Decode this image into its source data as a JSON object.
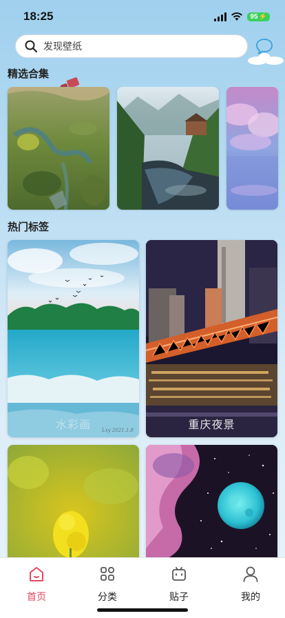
{
  "status_bar": {
    "time": "18:25",
    "battery": "95",
    "battery_color": "#39d15c"
  },
  "search": {
    "placeholder": "发现壁纸",
    "icon": "search-icon"
  },
  "header": {
    "chat_icon": "chat-bubble-icon"
  },
  "sections": {
    "featured_title": "精选合集",
    "tags_title": "热门标签"
  },
  "featured": [
    {
      "name": "aerial-valley"
    },
    {
      "name": "mountain-river-village"
    },
    {
      "name": "pink-clouds-sea"
    }
  ],
  "tags": [
    {
      "label": "水彩画",
      "signature": "Lxy 2021.1.8"
    },
    {
      "label": "重庆夜景"
    },
    {
      "label": ""
    },
    {
      "label": ""
    }
  ],
  "tab_bar": {
    "active_color": "#e6465f",
    "items": [
      {
        "label": "首页",
        "icon": "home-icon",
        "active": true
      },
      {
        "label": "分类",
        "icon": "category-grid-icon",
        "active": false
      },
      {
        "label": "贴子",
        "icon": "post-icon",
        "active": false
      },
      {
        "label": "我的",
        "icon": "profile-icon",
        "active": false
      }
    ]
  }
}
